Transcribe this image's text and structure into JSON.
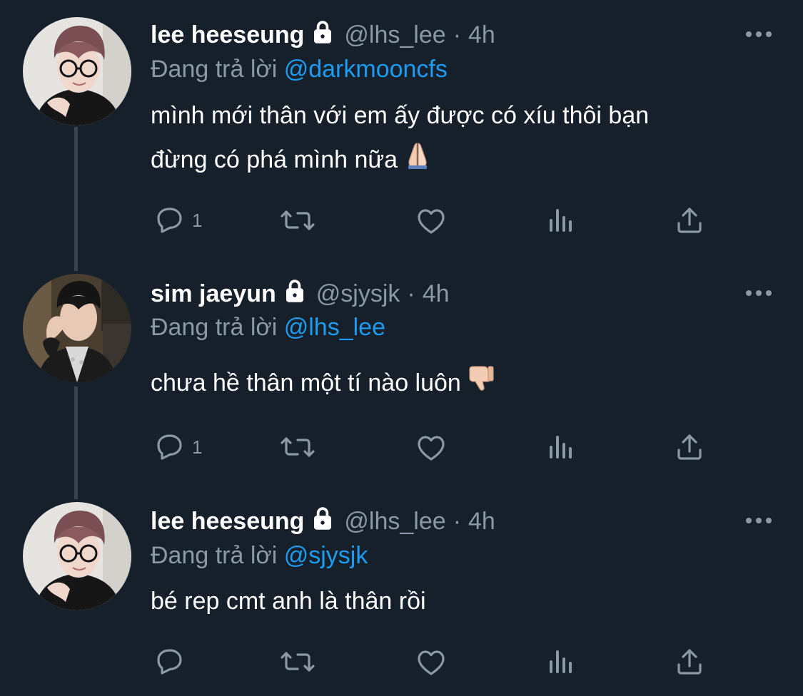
{
  "tweets": [
    {
      "display_name": "lee heeseung",
      "handle": "@lhs_lee",
      "separator": "·",
      "time": "4h",
      "reply_prefix": "Đang trả lời",
      "reply_to": "@darkmooncfs",
      "text_line1": "mình mới thân với em ấy được có xíu thôi bạn",
      "text_line2": "đừng có phá mình nữa",
      "emoji": "folded-hands",
      "reply_count": "1",
      "protected": true
    },
    {
      "display_name": "sim jaeyun",
      "handle": "@sjysjk",
      "separator": "·",
      "time": "4h",
      "reply_prefix": "Đang trả lời",
      "reply_to": "@lhs_lee",
      "text_line1": "chưa hề thân một tí nào luôn",
      "emoji": "thumbs-down",
      "reply_count": "1",
      "protected": true
    },
    {
      "display_name": "lee heeseung",
      "handle": "@lhs_lee",
      "separator": "·",
      "time": "4h",
      "reply_prefix": "Đang trả lời",
      "reply_to": "@sjysjk",
      "text_line1": "bé rep cmt anh là thân rồi",
      "reply_count": "",
      "protected": true
    }
  ],
  "colors": {
    "background": "#15202b",
    "text": "#ffffff",
    "secondary": "#8b98a5",
    "accent": "#1d9bf0",
    "thread_line": "#38444d"
  },
  "icons": [
    "lock-icon",
    "more-icon",
    "reply-icon",
    "retweet-icon",
    "like-icon",
    "views-icon",
    "share-icon"
  ]
}
